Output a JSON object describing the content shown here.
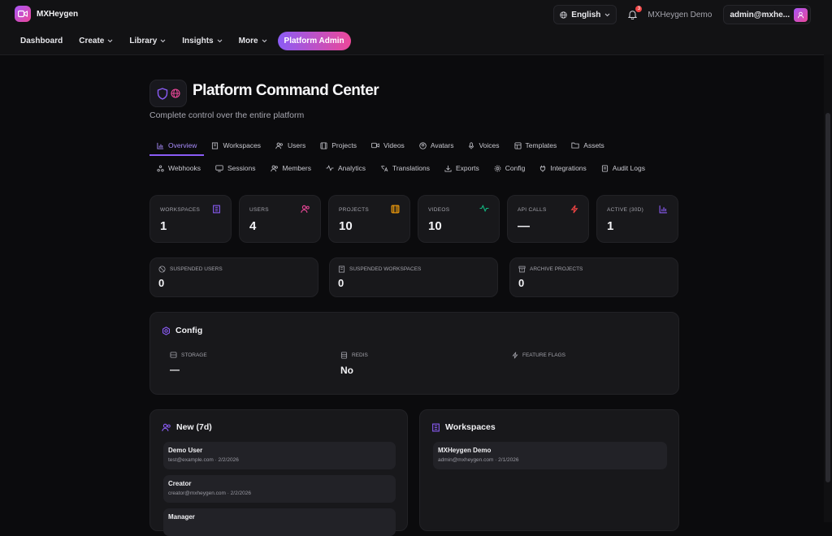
{
  "brand": {
    "name": "MXHeygen"
  },
  "nav": {
    "items": [
      {
        "label": "Dashboard",
        "caret": false
      },
      {
        "label": "Create",
        "caret": true
      },
      {
        "label": "Library",
        "caret": true
      },
      {
        "label": "Insights",
        "caret": true
      },
      {
        "label": "More",
        "caret": true
      }
    ],
    "admin_label": "Platform Admin"
  },
  "topbar": {
    "language": "English",
    "notification_count": "3",
    "tenant": "MXHeygen Demo",
    "account": "admin@mxhe..."
  },
  "page": {
    "title": "Platform Command Center",
    "subtitle": "Complete control over the entire platform"
  },
  "tabs_row1": [
    {
      "label": "Overview",
      "icon": "bar-chart-icon",
      "active": true
    },
    {
      "label": "Workspaces",
      "icon": "building-icon"
    },
    {
      "label": "Users",
      "icon": "users-icon"
    },
    {
      "label": "Projects",
      "icon": "film-icon"
    },
    {
      "label": "Videos",
      "icon": "video-icon"
    },
    {
      "label": "Avatars",
      "icon": "avatar-icon"
    },
    {
      "label": "Voices",
      "icon": "mic-icon"
    },
    {
      "label": "Templates",
      "icon": "template-icon"
    },
    {
      "label": "Assets",
      "icon": "folder-icon"
    }
  ],
  "tabs_row2": [
    {
      "label": "Webhooks",
      "icon": "webhook-icon"
    },
    {
      "label": "Sessions",
      "icon": "monitor-icon"
    },
    {
      "label": "Members",
      "icon": "members-icon"
    },
    {
      "label": "Analytics",
      "icon": "activity-icon"
    },
    {
      "label": "Translations",
      "icon": "translate-icon"
    },
    {
      "label": "Exports",
      "icon": "download-icon"
    },
    {
      "label": "Config",
      "icon": "gear-icon"
    },
    {
      "label": "Integrations",
      "icon": "plug-icon"
    },
    {
      "label": "Audit Logs",
      "icon": "log-icon"
    }
  ],
  "stats": [
    {
      "label": "WORKSPACES",
      "value": "1",
      "icon": "building-icon",
      "color": "#8b5cf6"
    },
    {
      "label": "USERS",
      "value": "4",
      "icon": "users-icon",
      "color": "#ec4899"
    },
    {
      "label": "PROJECTS",
      "value": "10",
      "icon": "film-icon",
      "color": "#f59e0b"
    },
    {
      "label": "VIDEOS",
      "value": "10",
      "icon": "activity-icon",
      "color": "#10b981"
    },
    {
      "label": "API CALLS",
      "value": "—",
      "icon": "zap-icon",
      "color": "#ef4444"
    },
    {
      "label": "ACTIVE (30D)",
      "value": "1",
      "icon": "bar-chart-icon",
      "color": "#8b5cf6"
    }
  ],
  "secondary_stats": [
    {
      "label": "SUSPENDED USERS",
      "value": "0",
      "icon": "ban-icon"
    },
    {
      "label": "SUSPENDED WORKSPACES",
      "value": "0",
      "icon": "building-icon"
    },
    {
      "label": "ARCHIVE PROJECTS",
      "value": "0",
      "icon": "archive-icon"
    }
  ],
  "config": {
    "title": "Config",
    "items": [
      {
        "label": "STORAGE",
        "value": "—",
        "icon": "storage-icon"
      },
      {
        "label": "REDIS",
        "value": "No",
        "icon": "database-icon"
      },
      {
        "label": "FEATURE FLAGS",
        "value": "",
        "icon": "zap-icon"
      }
    ]
  },
  "new_users": {
    "title": "New (7d)",
    "items": [
      {
        "name": "Demo User",
        "meta": "test@example.com · 2/2/2026"
      },
      {
        "name": "Creator",
        "meta": "creator@mxheygen.com · 2/2/2026"
      },
      {
        "name": "Manager",
        "meta": ""
      }
    ]
  },
  "workspaces": {
    "title": "Workspaces",
    "items": [
      {
        "name": "MXHeygen Demo",
        "meta": "admin@mxheygen.com · 2/1/2026"
      }
    ]
  },
  "colors": {
    "accent": "#8b5cf6",
    "accent2": "#ec4899",
    "bg": "#0b0b0d",
    "card": "#18181b"
  }
}
